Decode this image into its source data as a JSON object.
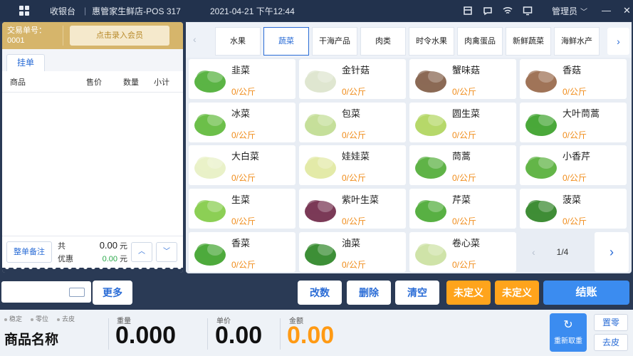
{
  "topbar": {
    "app": "收银台",
    "sep": "|",
    "store": "惠管家生鲜店-POS 317",
    "datetime": "2021-04-21 下午12:44",
    "user": "管理员",
    "user_chevron": "﹀",
    "icons": [
      "drawer-icon",
      "message-icon",
      "wifi-icon",
      "monitor-icon"
    ]
  },
  "order": {
    "txn_label": "交易单号：",
    "txn_no": "0001",
    "member_btn": "点击录入会员",
    "tab": "挂单",
    "cols": [
      "商品",
      "售价",
      "数量",
      "小计"
    ],
    "note_btn": "整单备注",
    "total_label": "共",
    "total_value": "0.00",
    "discount_label": "优惠",
    "discount_value": "0.00",
    "unit": "元",
    "up": "︿",
    "down": "﹀"
  },
  "categories": {
    "items": [
      "水果",
      "蔬菜",
      "干海产品",
      "肉类",
      "时令水果",
      "肉禽蛋品",
      "新鲜蔬菜",
      "海鲜水产"
    ],
    "active": "蔬菜",
    "prev": "‹",
    "next": "›"
  },
  "products": [
    {
      "name": "韭菜",
      "price": "0/公斤"
    },
    {
      "name": "金针菇",
      "price": "0/公斤"
    },
    {
      "name": "蟹味菇",
      "price": "0/公斤"
    },
    {
      "name": "香菇",
      "price": "0/公斤"
    },
    {
      "name": "冰菜",
      "price": "0/公斤"
    },
    {
      "name": "包菜",
      "price": "0/公斤"
    },
    {
      "name": "圆生菜",
      "price": "0/公斤"
    },
    {
      "name": "大叶茼蒿",
      "price": "0/公斤"
    },
    {
      "name": "大白菜",
      "price": "0/公斤"
    },
    {
      "name": "娃娃菜",
      "price": "0/公斤"
    },
    {
      "name": "茼蒿",
      "price": "0/公斤"
    },
    {
      "name": "小香芹",
      "price": "0/公斤"
    },
    {
      "name": "生菜",
      "price": "0/公斤"
    },
    {
      "name": "紫叶生菜",
      "price": "0/公斤"
    },
    {
      "name": "芹菜",
      "price": "0/公斤"
    },
    {
      "name": "菠菜",
      "price": "0/公斤"
    },
    {
      "name": "香菜",
      "price": "0/公斤"
    },
    {
      "name": "油菜",
      "price": "0/公斤"
    },
    {
      "name": "卷心菜",
      "price": "0/公斤"
    }
  ],
  "pager": {
    "page": "1/4",
    "prev": "‹",
    "next": "›"
  },
  "actions": {
    "more": "更多",
    "edit_qty": "改数",
    "delete": "删除",
    "clear": "清空",
    "undef1": "未定义",
    "undef2": "未定义",
    "checkout": "结账"
  },
  "scale": {
    "flags": [
      "稳定",
      "零位",
      "去皮"
    ],
    "product_name": "商品名称",
    "weight_label": "重量",
    "weight": "0.000",
    "unit_price_label": "单价",
    "unit_price": "0.00",
    "amount_label": "金额",
    "amount": "0.00",
    "retare": "重新取重",
    "zero": "置零",
    "tare": "去皮"
  },
  "colors": {
    "accent": "#2a6cd6",
    "price": "#f08c1a",
    "header_gold": "#d6b56b",
    "orange_button": "#ffa41c",
    "checkout_blue": "#3b8cf0"
  }
}
